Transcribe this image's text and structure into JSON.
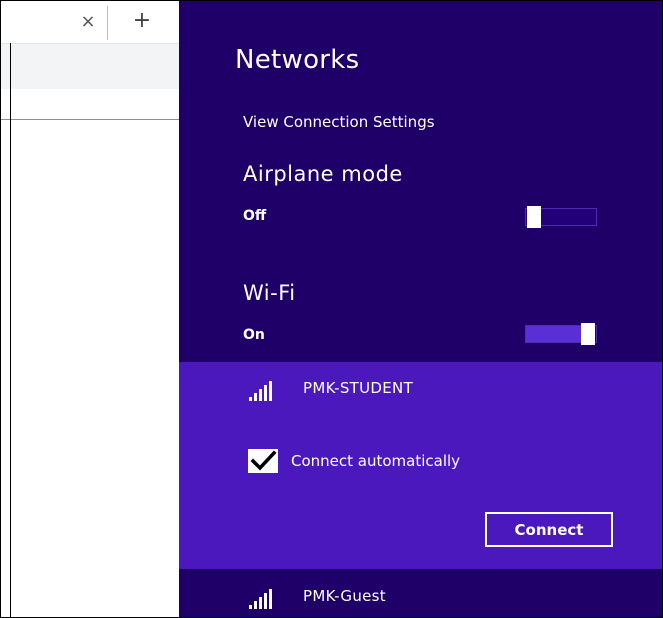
{
  "browser": {
    "tab_close_glyph": "×",
    "new_tab_glyph": "+"
  },
  "charm": {
    "title": "Networks",
    "view_settings_label": "View Connection Settings",
    "airplane": {
      "title": "Airplane mode",
      "state": "Off",
      "on": false
    },
    "wifi": {
      "title": "Wi-Fi",
      "state": "On",
      "on": true
    },
    "networks": [
      {
        "name": "PMK-STUDENT",
        "selected": true,
        "connect_auto_label": "Connect automatically",
        "connect_auto_checked": true,
        "connect_button_label": "Connect"
      },
      {
        "name": "PMK-Guest",
        "selected": false
      }
    ],
    "colors": {
      "background": "#1f0068",
      "selected_background": "#4b18bd",
      "text": "#ffffff"
    }
  }
}
